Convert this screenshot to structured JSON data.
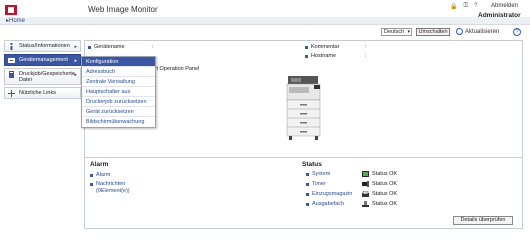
{
  "header": {
    "app_title": "Web Image Monitor",
    "logout": "Abmelden",
    "user": "Administrator",
    "home": "Home"
  },
  "toolbar": {
    "language": "Deutsch",
    "switch_label": "Umschalten",
    "refresh_label": "Aktualisieren",
    "help_label": "?"
  },
  "sidebar": {
    "items": [
      {
        "label": "Status/Informationen"
      },
      {
        "label": "Gerätemanagement"
      },
      {
        "label": "Druckjob/Gespeicherte Datei"
      },
      {
        "label": "Nützliche Links"
      }
    ]
  },
  "menu": {
    "items": [
      {
        "label": "Konfiguration"
      },
      {
        "label": "Adressbuch"
      },
      {
        "label": "Zentrale Verwaltung"
      },
      {
        "label": "Hauptschalter aus"
      },
      {
        "label": "Druckerjob zurücksetzen"
      },
      {
        "label": "Gerät zurücksetzen"
      },
      {
        "label": "Bildschirmüberwachung"
      }
    ]
  },
  "info": {
    "device_name_label": "Gerätename",
    "device_name_value": ":",
    "panel_label": "mart Operation Panel",
    "comment_label": "Kommentar",
    "comment_value": ":",
    "hostname_label": "Hostname",
    "hostname_value": ":"
  },
  "alarm": {
    "title": "Alarm",
    "links": [
      "Alarm",
      "Nachrichten",
      "(0Element(e))"
    ]
  },
  "status": {
    "title": "Status",
    "rows": [
      {
        "name": "System",
        "value": "Status OK"
      },
      {
        "name": "Toner",
        "value": "Status OK"
      },
      {
        "name": "Einzugsmagazin",
        "value": "Status OK"
      },
      {
        "name": "Ausgabefach",
        "value": "Status OK"
      }
    ]
  },
  "details_label": "Details überprüfen"
}
